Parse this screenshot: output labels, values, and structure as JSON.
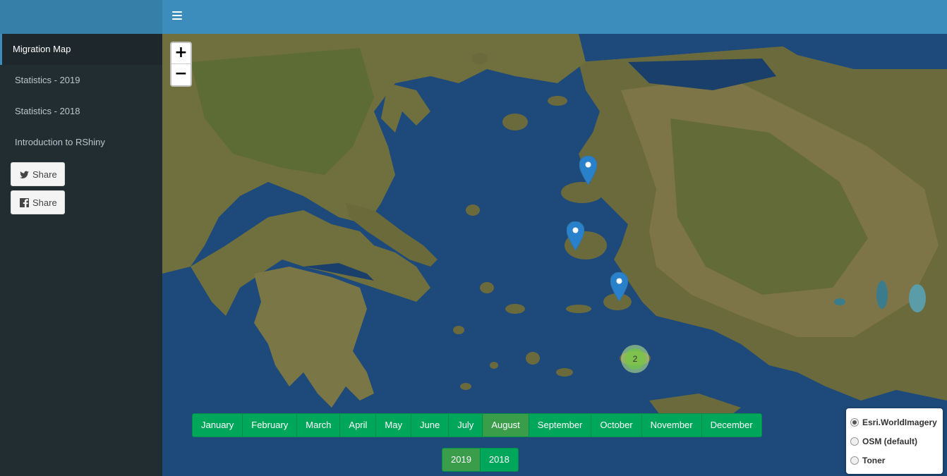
{
  "sidebar": {
    "items": [
      {
        "label": "Migration Map",
        "active": true
      },
      {
        "label": "Statistics - 2019"
      },
      {
        "label": "Statistics - 2018"
      },
      {
        "label": "Introduction to RShiny"
      }
    ],
    "share_twitter": "Share",
    "share_facebook": "Share"
  },
  "colors": {
    "header": "#3c8dbc",
    "logo": "#367fa9",
    "sidebar": "#222d32",
    "button_green": "#00a65a",
    "marker_blue": "#2a81cb"
  },
  "map": {
    "cluster_count": "2",
    "months": [
      "January",
      "February",
      "March",
      "April",
      "May",
      "June",
      "July",
      "August",
      "September",
      "October",
      "November",
      "December"
    ],
    "active_month": "August",
    "years": [
      "2019",
      "2018"
    ],
    "active_year": "2019",
    "zoom_in": "+",
    "zoom_out": "−",
    "layers": [
      {
        "label": "Esri.WorldImagery",
        "checked": true
      },
      {
        "label": "OSM (default)"
      },
      {
        "label": "Toner"
      }
    ]
  }
}
